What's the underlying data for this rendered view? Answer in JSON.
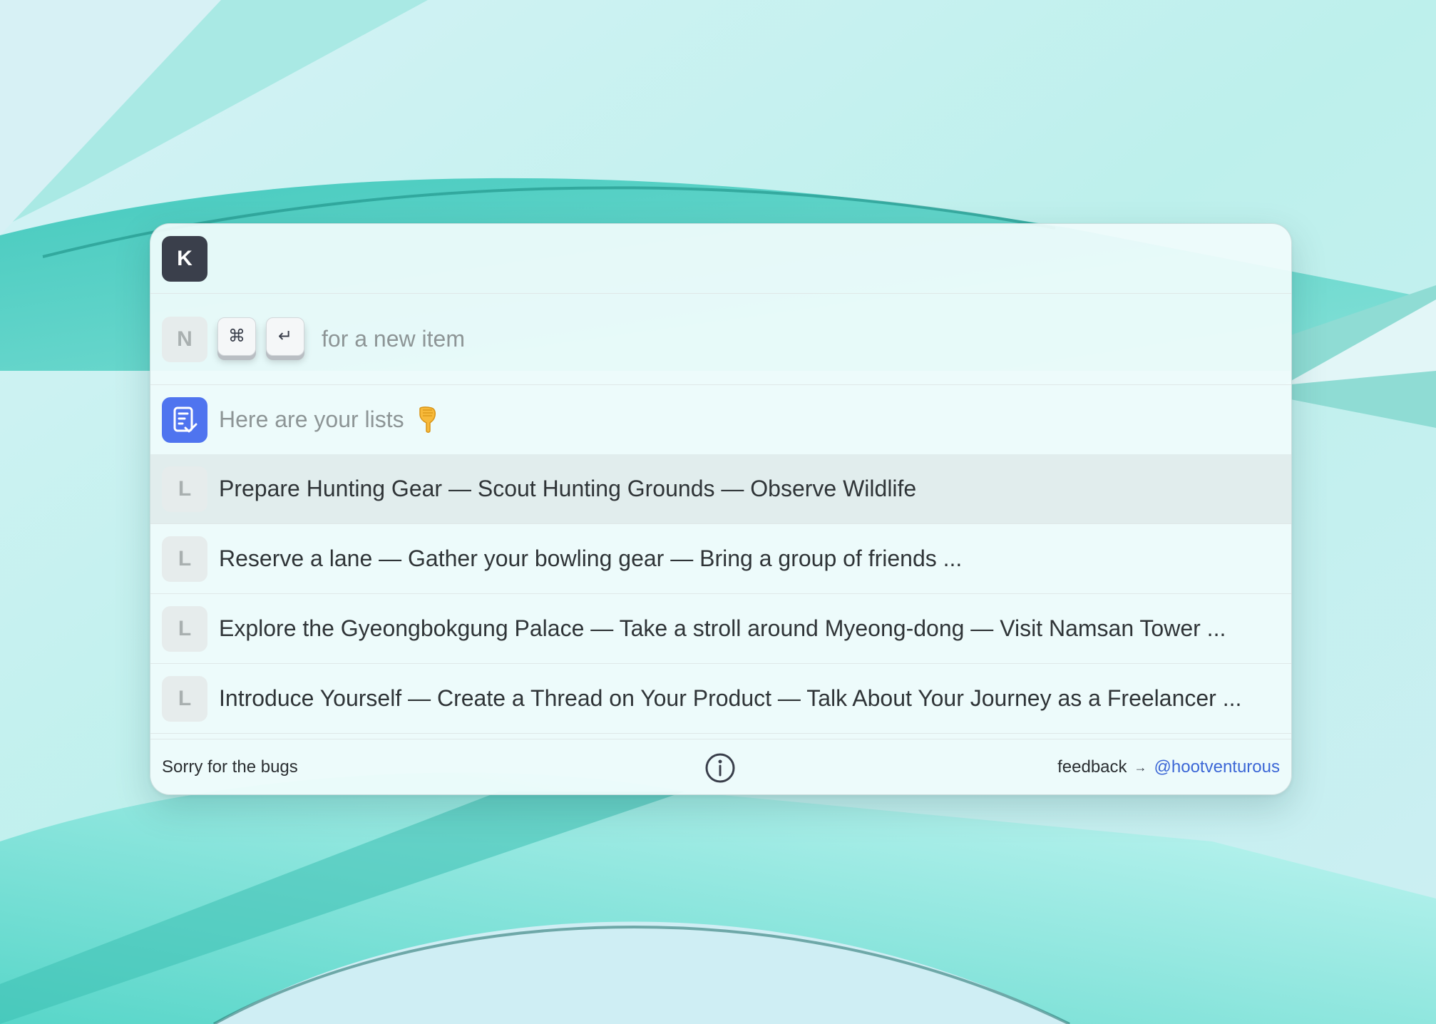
{
  "app": {
    "logo_letter": "K"
  },
  "new_item": {
    "letter": "N",
    "key_command": "⌘",
    "key_return": "↵",
    "hint": "for a new item"
  },
  "lists_header": {
    "title": "Here are your lists",
    "icon": "checklist-icon",
    "pointing_icon": "backhand-index-pointing-down-icon"
  },
  "lists": [
    {
      "letter": "L",
      "text": "Prepare Hunting Gear — Scout Hunting Grounds — Observe Wildlife",
      "highlighted": true
    },
    {
      "letter": "L",
      "text": "Reserve a lane — Gather your bowling gear — Bring a group of friends ...",
      "highlighted": false
    },
    {
      "letter": "L",
      "text": "Explore the Gyeongbokgung Palace — Take a stroll around Myeong-dong — Visit Namsan Tower ...",
      "highlighted": false
    },
    {
      "letter": "L",
      "text": "Introduce Yourself — Create a Thread on Your Product — Talk About Your Journey as a Freelancer ...",
      "highlighted": false
    }
  ],
  "footer": {
    "left_text": "Sorry for the bugs",
    "feedback_label": "feedback",
    "arrow": "→",
    "handle": "@hootventurous"
  },
  "colors": {
    "accent_blue": "#4f74ef",
    "link": "#3c67d6",
    "dark_badge": "#3a3f4b"
  }
}
